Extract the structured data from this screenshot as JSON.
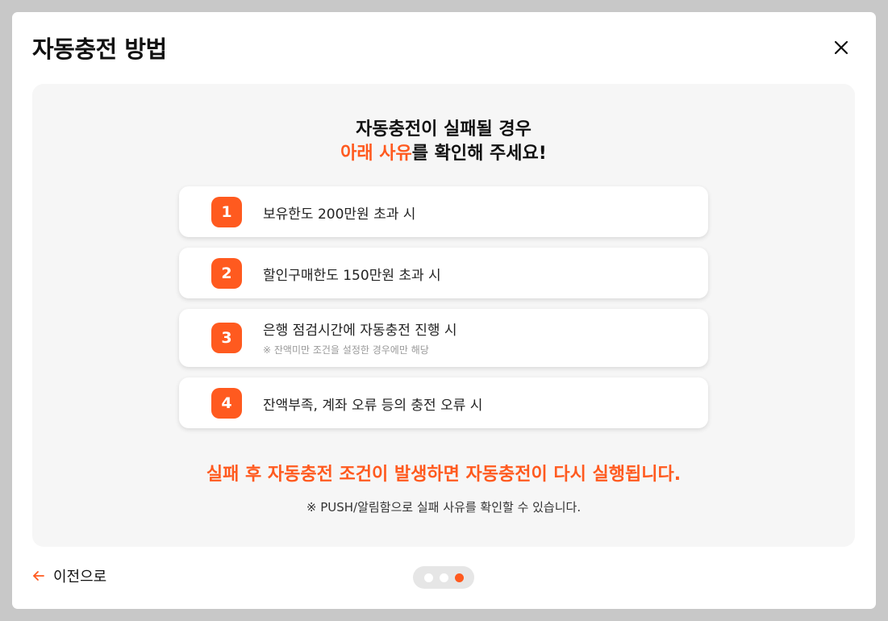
{
  "modal": {
    "title": "자동충전 방법",
    "close_icon": "close-icon"
  },
  "panel": {
    "headline_line1": "자동충전이 실패될 경우",
    "headline_accent": "아래 사유",
    "headline_rest": "를 확인해 주세요!",
    "items": [
      {
        "num": "1",
        "text": "보유한도 200만원 초과 시",
        "sub": ""
      },
      {
        "num": "2",
        "text": "할인구매한도 150만원 초과 시",
        "sub": ""
      },
      {
        "num": "3",
        "text": "은행 점검시간에 자동충전 진행 시",
        "sub": "※ 잔액미만 조건을 설정한 경우에만 해당"
      },
      {
        "num": "4",
        "text": "잔액부족, 계좌 오류 등의 충전 오류 시",
        "sub": ""
      }
    ],
    "notice": "실패 후 자동충전 조건이 발생하면 자동충전이 다시 실행됩니다.",
    "subnote": "※ PUSH/알림함으로 실패 사유를 확인할 수 있습니다."
  },
  "footer": {
    "back_label": "이전으로",
    "back_icon": "arrow-left-icon",
    "pagination": {
      "total": 3,
      "active": 3
    }
  },
  "colors": {
    "accent": "#ff5a1f",
    "panel_bg": "#f6f6f6",
    "overlay": "#c8c8c8"
  }
}
